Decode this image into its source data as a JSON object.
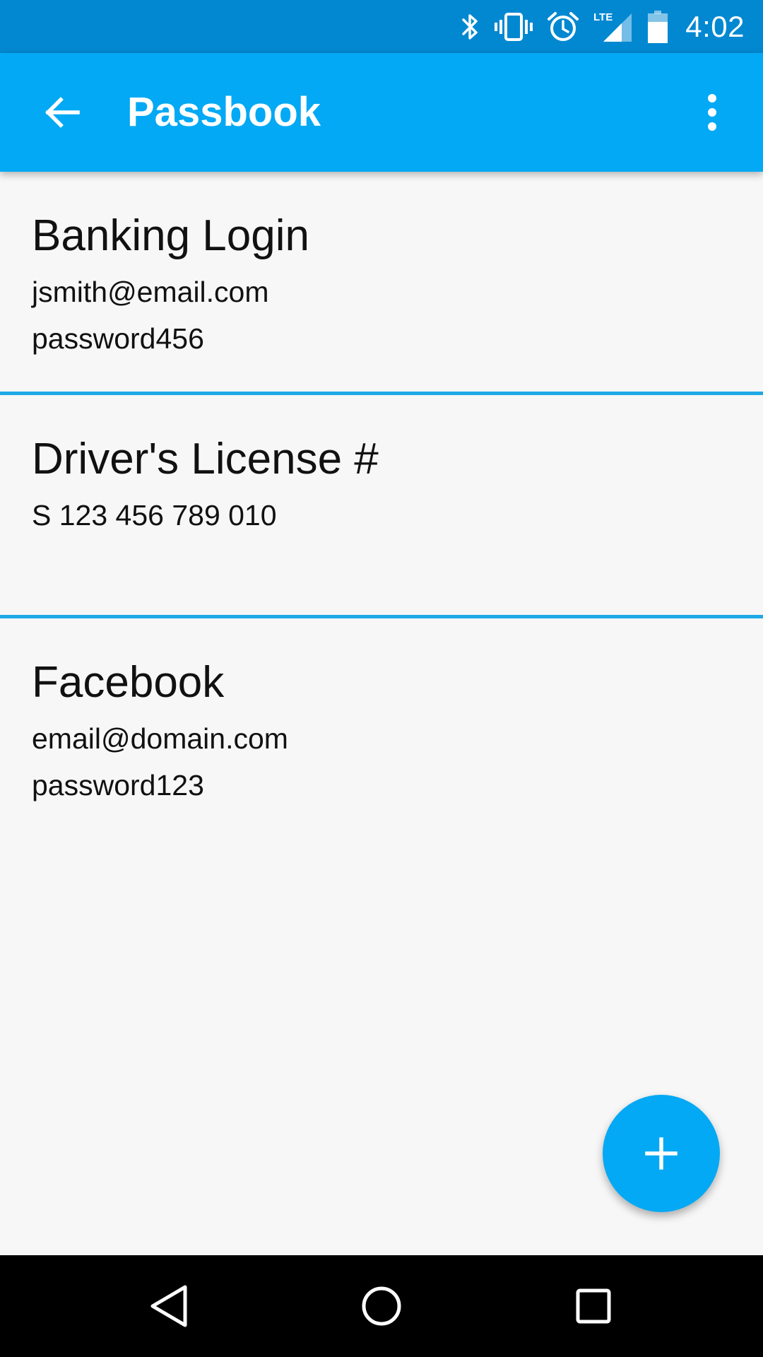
{
  "status_bar": {
    "time": "4:02",
    "icons": [
      "bluetooth-icon",
      "vibrate-icon",
      "alarm-icon",
      "lte-signal-icon",
      "battery-icon"
    ],
    "network_label": "LTE"
  },
  "app_bar": {
    "title": "Passbook",
    "back_icon": "arrow-back-icon",
    "menu_icon": "more-vert-icon"
  },
  "entries": [
    {
      "title": "Banking Login",
      "line1": "jsmith@email.com",
      "line2": "password456"
    },
    {
      "title": "Driver's License #",
      "line1": "S 123 456 789 010",
      "line2": ""
    },
    {
      "title": "Facebook",
      "line1": "email@domain.com",
      "line2": "password123"
    }
  ],
  "fab": {
    "icon": "add-icon"
  },
  "nav_bar": {
    "icons": [
      "nav-back-icon",
      "nav-home-icon",
      "nav-recents-icon"
    ]
  },
  "colors": {
    "status_bar": "#0288d1",
    "app_bar": "#03a9f4",
    "divider": "#1ea9e6",
    "background": "#f7f7f7",
    "nav_bar": "#000000"
  }
}
